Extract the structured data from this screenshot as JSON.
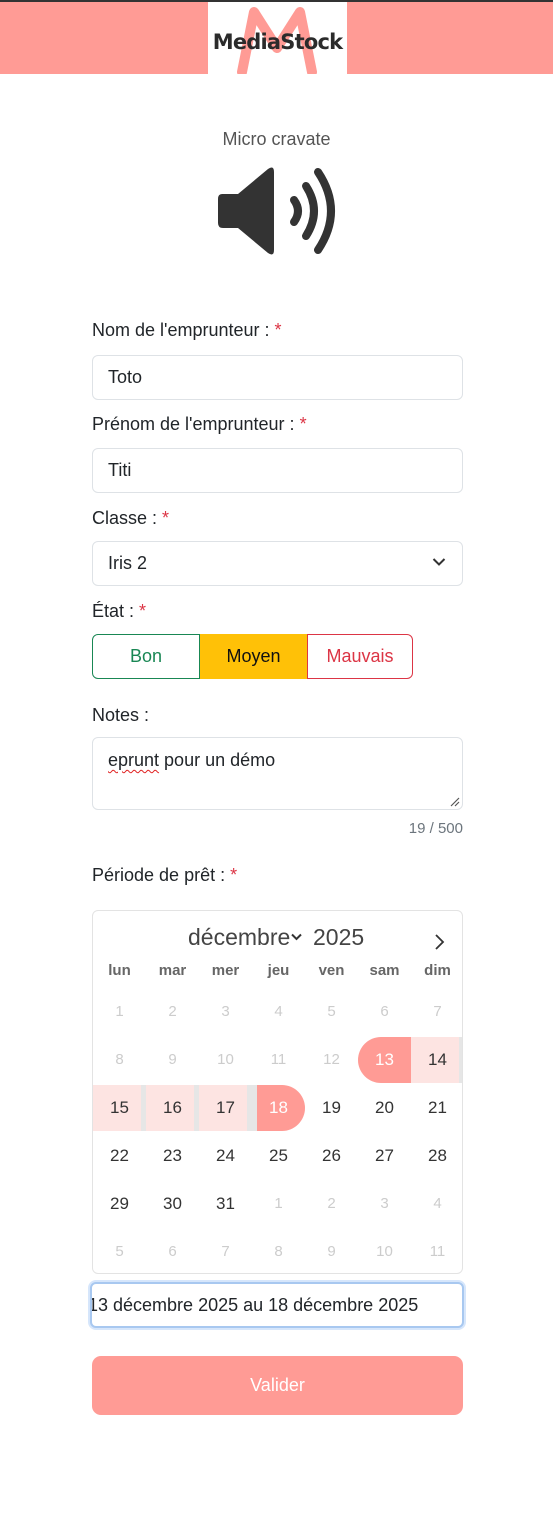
{
  "header": {
    "brand": "MediaStock",
    "colors": {
      "brand": "#ff9b95",
      "success": "#198754",
      "warning": "#ffc107",
      "danger": "#dc3545"
    }
  },
  "item": {
    "name": "Micro cravate",
    "icon": "speaker-icon"
  },
  "form": {
    "nom": {
      "label": "Nom de l'emprunteur :",
      "required": "*",
      "value": "Toto"
    },
    "prenom": {
      "label": "Prénom de l'emprunteur :",
      "required": "*",
      "value": "Titi"
    },
    "classe": {
      "label": "Classe :",
      "required": "*",
      "value": "Iris 2"
    },
    "etat": {
      "label": "État :",
      "required": "*",
      "options": [
        "Bon",
        "Moyen",
        "Mauvais"
      ],
      "selected": "Moyen"
    },
    "notes": {
      "label": "Notes :",
      "value_misspelled": "eprunt",
      "value_rest": " pour un démo",
      "counter": "19 / 500"
    },
    "periode": {
      "label": "Période de prêt :",
      "required": "*",
      "value": "13 décembre 2025 au 18 décembre 2025"
    },
    "submit_label": "Valider"
  },
  "calendar": {
    "month": "décembre",
    "year": "2025",
    "weekdays": [
      "lun",
      "mar",
      "mer",
      "jeu",
      "ven",
      "sam",
      "dim"
    ],
    "weeks": [
      [
        {
          "d": "1",
          "m": true
        },
        {
          "d": "2",
          "m": true
        },
        {
          "d": "3",
          "m": true
        },
        {
          "d": "4",
          "m": true
        },
        {
          "d": "5",
          "m": true
        },
        {
          "d": "6",
          "m": true
        },
        {
          "d": "7",
          "m": true
        }
      ],
      [
        {
          "d": "8",
          "m": true
        },
        {
          "d": "9",
          "m": true
        },
        {
          "d": "10",
          "m": true
        },
        {
          "d": "11",
          "m": true
        },
        {
          "d": "12",
          "m": true
        },
        {
          "d": "13",
          "s": "start"
        },
        {
          "d": "14",
          "s": "range"
        }
      ],
      [
        {
          "d": "15",
          "s": "range"
        },
        {
          "d": "16",
          "s": "range"
        },
        {
          "d": "17",
          "s": "range"
        },
        {
          "d": "18",
          "s": "end"
        },
        {
          "d": "19"
        },
        {
          "d": "20"
        },
        {
          "d": "21"
        }
      ],
      [
        {
          "d": "22"
        },
        {
          "d": "23"
        },
        {
          "d": "24"
        },
        {
          "d": "25"
        },
        {
          "d": "26"
        },
        {
          "d": "27"
        },
        {
          "d": "28"
        }
      ],
      [
        {
          "d": "29"
        },
        {
          "d": "30"
        },
        {
          "d": "31"
        },
        {
          "d": "1",
          "m": true
        },
        {
          "d": "2",
          "m": true
        },
        {
          "d": "3",
          "m": true
        },
        {
          "d": "4",
          "m": true
        }
      ],
      [
        {
          "d": "5",
          "m": true
        },
        {
          "d": "6",
          "m": true
        },
        {
          "d": "7",
          "m": true
        },
        {
          "d": "8",
          "m": true
        },
        {
          "d": "9",
          "m": true
        },
        {
          "d": "10",
          "m": true
        },
        {
          "d": "11",
          "m": true
        }
      ]
    ]
  }
}
